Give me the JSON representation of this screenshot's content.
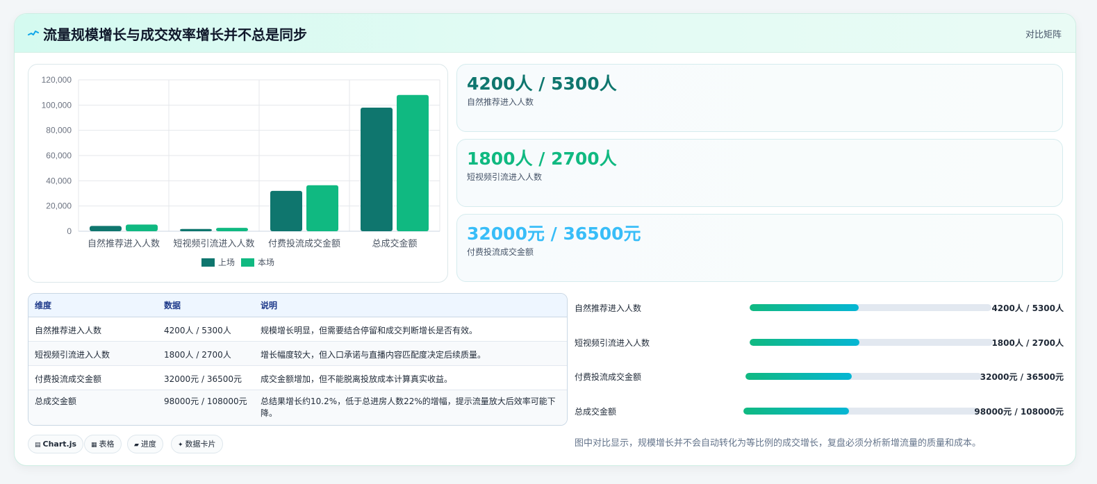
{
  "header": {
    "title": "流量规模增长与成交效率增长并不总是同步",
    "link": "对比矩阵"
  },
  "chart_data": {
    "type": "bar",
    "categories": [
      "自然推荐进入人数",
      "短视频引流进入人数",
      "付费投流成交金额",
      "总成交金额"
    ],
    "series": [
      {
        "name": "上场",
        "values": [
          4200,
          1800,
          32000,
          98000
        ],
        "color": "#0f766e"
      },
      {
        "name": "本场",
        "values": [
          5300,
          2700,
          36500,
          108000
        ],
        "color": "#10b981"
      }
    ],
    "yticks": [
      "0",
      "20,000",
      "40,000",
      "60,000",
      "80,000",
      "100,000",
      "120,000"
    ],
    "ylim": [
      0,
      120000
    ],
    "grid": true,
    "legend": "bottom"
  },
  "stats": [
    {
      "value": "4200人 / 5300人",
      "label": "自然推荐进入人数",
      "color": "#0f766e"
    },
    {
      "value": "1800人 / 2700人",
      "label": "短视频引流进入人数",
      "color": "#10b981"
    },
    {
      "value": "32000元 / 36500元",
      "label": "付费投流成交金额",
      "color": "#38bdf8"
    }
  ],
  "table": {
    "headers": [
      "维度",
      "数据",
      "说明"
    ],
    "rows": [
      [
        "自然推荐进入人数",
        "4200人 / 5300人",
        "规模增长明显，但需要结合停留和成交判断增长是否有效。"
      ],
      [
        "短视频引流进入人数",
        "1800人 / 2700人",
        "增长幅度较大，但入口承诺与直播内容匹配度决定后续质量。"
      ],
      [
        "付费投流成交金额",
        "32000元 / 36500元",
        "成交金额增加，但不能脱离投放成本计算真实收益。"
      ],
      [
        "总成交金额",
        "98000元 / 108000元",
        "总结果增长约10.2%，低于总进房人数22%的增幅，提示流量放大后效率可能下降。"
      ]
    ]
  },
  "progress": [
    {
      "label": "自然推荐进入人数",
      "value": "4200人 / 5300人",
      "ratio": 0.45
    },
    {
      "label": "短视频引流进入人数",
      "value": "1800人 / 2700人",
      "ratio": 0.45
    },
    {
      "label": "付费投流成交金额",
      "value": "32000元 / 36500元",
      "ratio": 0.45
    },
    {
      "label": "总成交金额",
      "value": "98000元 / 108000元",
      "ratio": 0.45
    }
  ],
  "summary": "图中对比显示，规模增长并不会自动转化为等比例的成交增长，复盘必须分析新增流量的质量和成本。",
  "chips": [
    {
      "icon": "▤",
      "label": "Chart.js"
    },
    {
      "icon": "▦",
      "label": "表格"
    },
    {
      "icon": "▰",
      "label": "进度"
    },
    {
      "icon": "✦",
      "label": "数据卡片"
    }
  ]
}
